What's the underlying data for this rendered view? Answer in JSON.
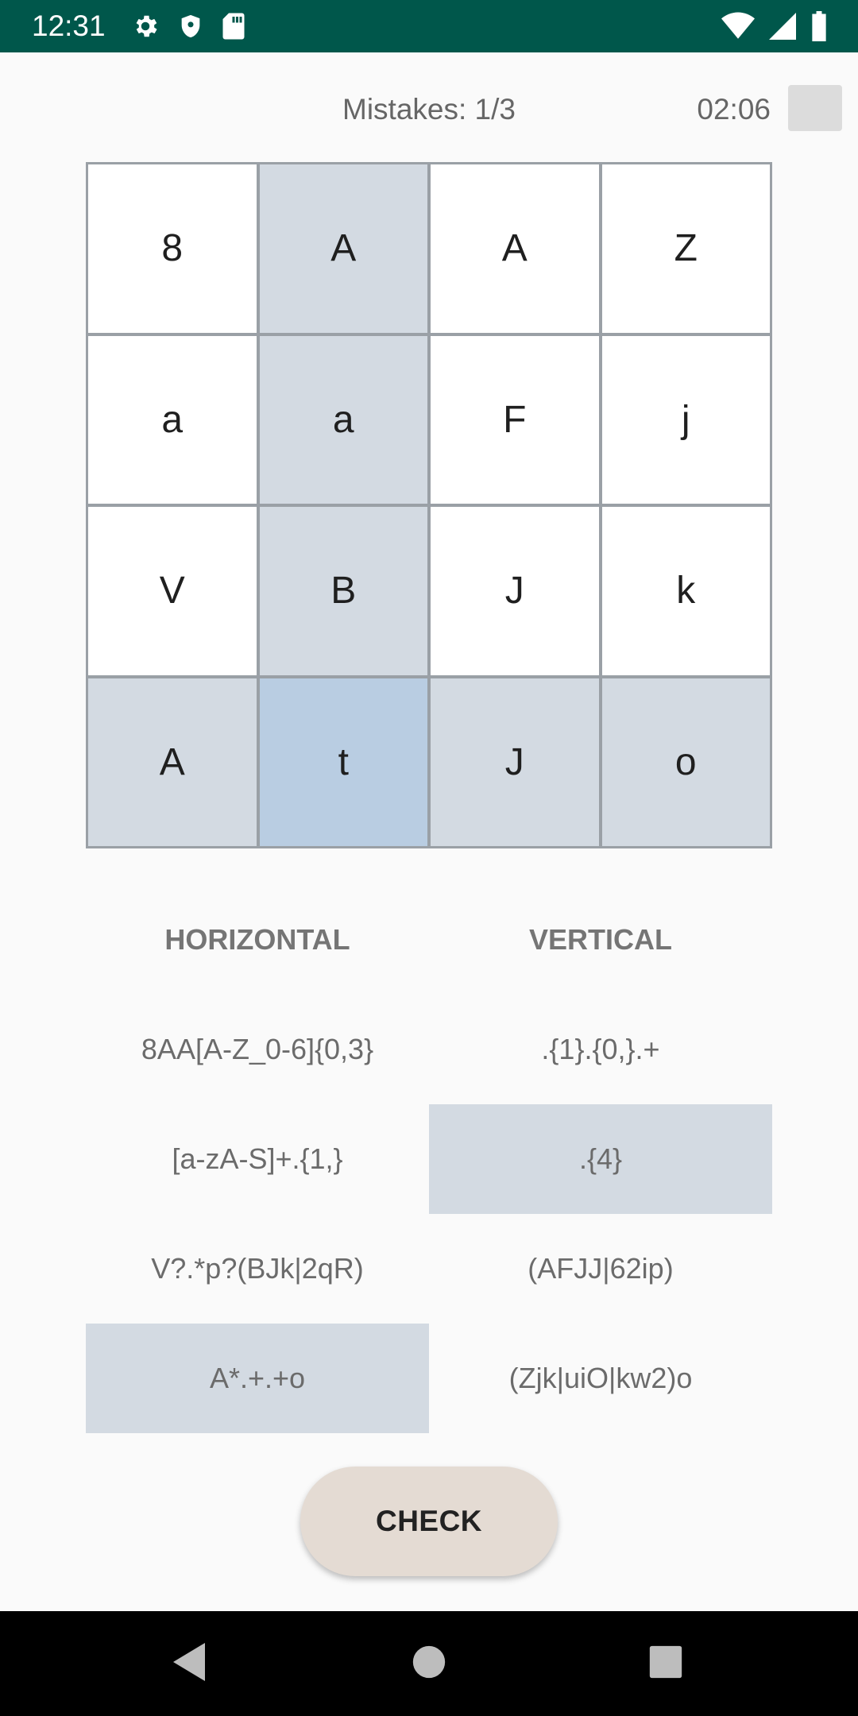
{
  "status_bar": {
    "time": "12:31",
    "left_icons": [
      "gear-icon",
      "shield-icon",
      "sd-card-icon"
    ],
    "right_icons": [
      "wifi-icon",
      "signal-icon",
      "battery-icon"
    ]
  },
  "header": {
    "mistakes": "Mistakes: 1/3",
    "timer": "02:06"
  },
  "grid": {
    "rows": [
      [
        "8",
        "A",
        "A",
        "Z"
      ],
      [
        "a",
        "a",
        "F",
        "j"
      ],
      [
        "V",
        "B",
        "J",
        "k"
      ],
      [
        "A",
        "t",
        "J",
        "o"
      ]
    ],
    "highlight_row": 3,
    "highlight_col": 1,
    "selected_cell": [
      3,
      1
    ]
  },
  "clues": {
    "horizontal_label": "HORIZONTAL",
    "vertical_label": "VERTICAL",
    "horizontal": [
      "8AA[A-Z_0-6]{0,3}",
      "[a-zA-S]+.{1,}",
      "V?.*p?(BJk|2qR)",
      "A*.+.+o"
    ],
    "vertical": [
      ".{1}.{0,}.+",
      ".{4}",
      "(AFJJ|62ip)",
      "(Zjk|uiO|kw2)o"
    ],
    "highlighted_horizontal": 3,
    "highlighted_vertical": 1
  },
  "actions": {
    "check_label": "CHECK"
  },
  "colors": {
    "status_bar": "#00574b",
    "cell_highlight": "#d3dae2",
    "cell_selected": "#b9cde2",
    "check_button": "#e4dbd3"
  },
  "nav_bar": {
    "icons": [
      "back-icon",
      "home-icon",
      "recents-icon"
    ]
  }
}
